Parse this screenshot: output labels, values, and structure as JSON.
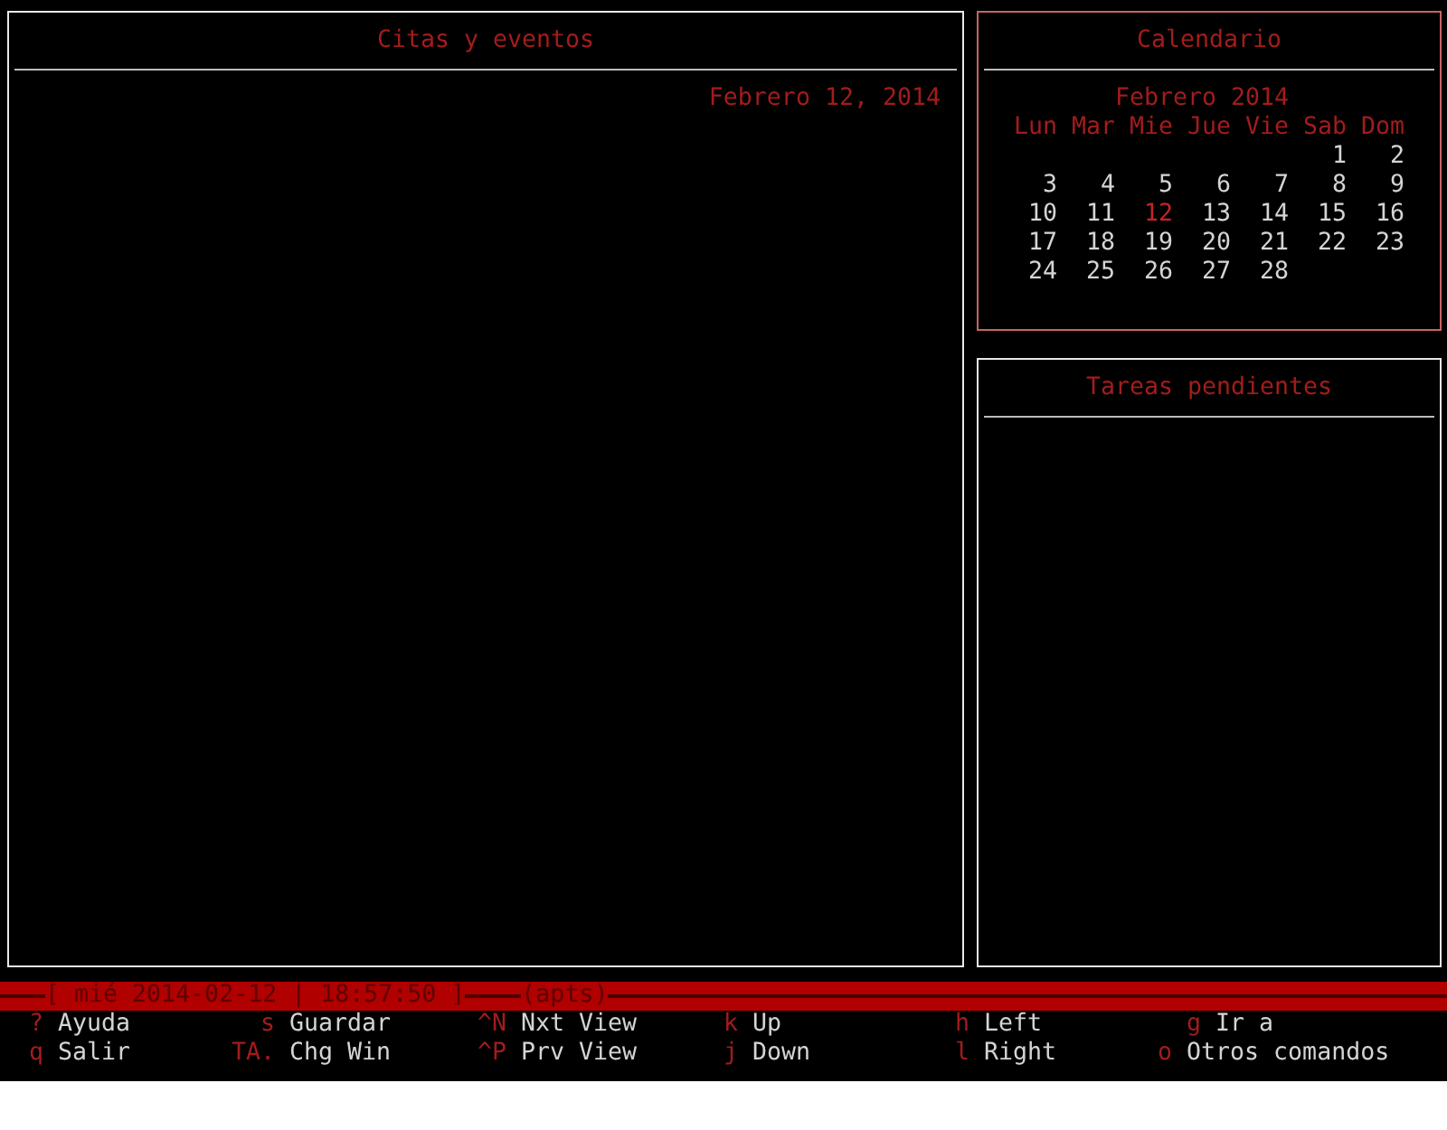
{
  "appointments": {
    "title": "Citas y eventos",
    "selected": false,
    "date": "Febrero 12, 2014"
  },
  "calendar": {
    "title": "Calendario",
    "selected": true,
    "month": "Febrero 2014",
    "weekdays": [
      "Lun",
      "Mar",
      "Mie",
      "Jue",
      "Vie",
      "Sab",
      "Dom"
    ],
    "weeks": [
      [
        {
          "day": "1",
          "selected": false
        },
        {
          "day": "2",
          "selected": false
        }
      ],
      [
        {
          "day": "3",
          "selected": false
        },
        {
          "day": "4",
          "selected": false
        },
        {
          "day": "5",
          "selected": false
        },
        {
          "day": "6",
          "selected": false
        },
        {
          "day": "7",
          "selected": false
        },
        {
          "day": "8",
          "selected": false
        },
        {
          "day": "9",
          "selected": false
        }
      ],
      [
        {
          "day": "10",
          "selected": false
        },
        {
          "day": "11",
          "selected": false
        },
        {
          "day": "12",
          "selected": true
        },
        {
          "day": "13",
          "selected": false
        },
        {
          "day": "14",
          "selected": false
        },
        {
          "day": "15",
          "selected": false
        },
        {
          "day": "16",
          "selected": false
        }
      ],
      [
        {
          "day": "17",
          "selected": false
        },
        {
          "day": "18",
          "selected": false
        },
        {
          "day": "19",
          "selected": false
        },
        {
          "day": "20",
          "selected": false
        },
        {
          "day": "21",
          "selected": false
        },
        {
          "day": "22",
          "selected": false
        },
        {
          "day": "23",
          "selected": false
        }
      ],
      [
        {
          "day": "24",
          "selected": false
        },
        {
          "day": "25",
          "selected": false
        },
        {
          "day": "26",
          "selected": false
        },
        {
          "day": "27",
          "selected": false
        },
        {
          "day": "28",
          "selected": false
        }
      ]
    ]
  },
  "todo": {
    "title": "Tareas pendientes",
    "selected": false
  },
  "status_bar": {
    "date_time": "[ mié 2014-02-12 | 18:57:50 ]",
    "mode": "(apts)"
  },
  "help": {
    "rows": [
      [
        {
          "key": "?",
          "label": "Ayuda"
        },
        {
          "key": "s",
          "label": "Guardar"
        },
        {
          "key": "^N",
          "label": "Nxt View"
        },
        {
          "key": "k",
          "label": "Up"
        },
        {
          "key": "h",
          "label": "Left"
        },
        {
          "key": "g",
          "label": "Ir a"
        }
      ],
      [
        {
          "key": "q",
          "label": "Salir"
        },
        {
          "key": "TA.",
          "label": "Chg Win"
        },
        {
          "key": "^P",
          "label": "Prv View"
        },
        {
          "key": "j",
          "label": "Down"
        },
        {
          "key": "l",
          "label": "Right"
        },
        {
          "key": "o",
          "label": "Otros comandos"
        }
      ]
    ]
  }
}
